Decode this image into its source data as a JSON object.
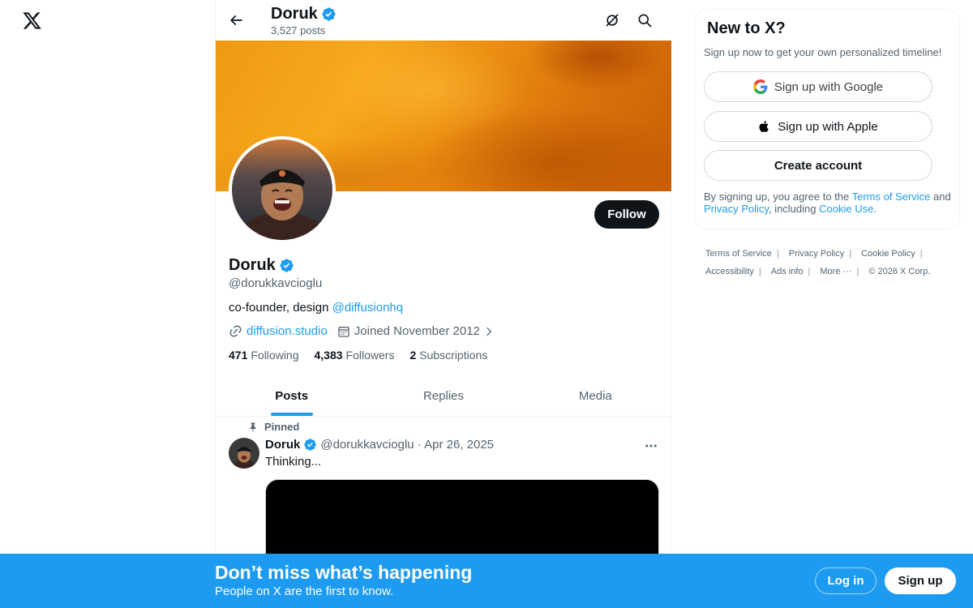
{
  "app": {
    "logo_icon": "x-logo-icon"
  },
  "header": {
    "name": "Doruk",
    "posts_count": "3,527 posts",
    "back_icon": "arrow-left-icon",
    "grok_icon": "grok-icon",
    "search_icon": "search-icon"
  },
  "profile": {
    "name": "Doruk",
    "handle": "@dorukkavcioglu",
    "bio_text": "co-founder, design ",
    "bio_mention": "@diffusionhq",
    "website": "diffusion.studio",
    "joined": "Joined November 2012",
    "follow_label": "Follow",
    "verified_icon": "verified-badge-icon",
    "stats": {
      "following_count": "471",
      "following_label": "Following",
      "followers_count": "4,383",
      "followers_label": "Followers",
      "subscriptions_count": "2",
      "subscriptions_label": "Subscriptions"
    }
  },
  "tabs": [
    {
      "label": "Posts",
      "active": true
    },
    {
      "label": "Replies",
      "active": false
    },
    {
      "label": "Media",
      "active": false
    }
  ],
  "post": {
    "pinned_label": "Pinned",
    "name": "Doruk",
    "handle_date": "@dorukkavcioglu · Apr 26, 2025",
    "text": "Thinking..."
  },
  "signup_card": {
    "title": "New to X?",
    "subtitle": "Sign up now to get your own personalized timeline!",
    "google_label": "Sign up with Google",
    "apple_label": "Sign up with Apple",
    "create_label": "Create account",
    "legal_prefix": "By signing up, you agree to the ",
    "terms_link": "Terms of Service",
    "legal_and": " and ",
    "privacy_link": "Privacy Policy",
    "legal_including": ", including ",
    "cookie_link": "Cookie Use",
    "legal_end": "."
  },
  "footer": {
    "terms": "Terms of Service",
    "privacy": "Privacy Policy",
    "cookie": "Cookie Policy",
    "accessibility": "Accessibility",
    "ads": "Ads info",
    "more": "More ···",
    "copyright": "© 2026 X Corp."
  },
  "bottom_bar": {
    "title": "Don’t miss what’s happening",
    "subtitle": "People on X are the first to know.",
    "login_label": "Log in",
    "signup_label": "Sign up"
  },
  "colors": {
    "accent": "#1d9bf0",
    "text_primary": "#0f1419",
    "text_secondary": "#536471"
  }
}
